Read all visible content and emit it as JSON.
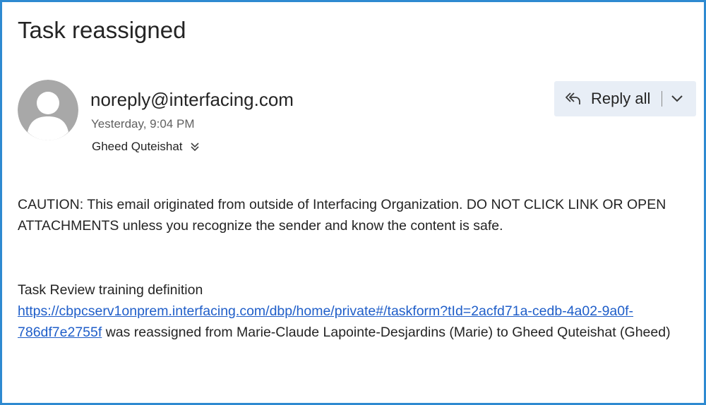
{
  "email": {
    "subject": "Task reassigned",
    "sender": "noreply@interfacing.com",
    "timestamp": "Yesterday, 9:04 PM",
    "recipient": "Gheed Quteishat",
    "avatar_icon": "person-avatar-icon",
    "expand_recipients_icon": "double-chevron-down-icon"
  },
  "reply": {
    "label": "Reply all",
    "icon": "reply-all-icon",
    "dropdown_icon": "chevron-down-icon"
  },
  "body": {
    "caution": "CAUTION: This email originated from outside of Interfacing Organization. DO NOT CLICK LINK OR OPEN ATTACHMENTS unless you recognize the sender and know the content is safe.",
    "task_title": "Task Review training definition",
    "task_link": "https://cbpcserv1onprem.interfacing.com/dbp/home/private#/taskform?tId=2acfd71a-cedb-4a02-9a0f-786df7e2755f",
    "task_message": " was reassigned from Marie-Claude Lapointe-Desjardins (Marie) to Gheed Quteishat (Gheed)"
  },
  "colors": {
    "frame_border": "#2e8ad1",
    "link": "#1f5ec9",
    "reply_background": "#e8eef6",
    "avatar_background": "#a8a8a8"
  }
}
